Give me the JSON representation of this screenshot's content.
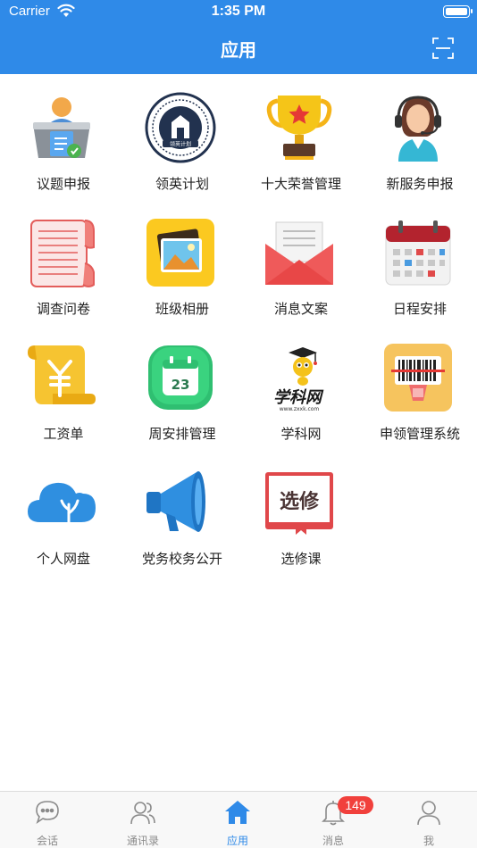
{
  "status_bar": {
    "carrier": "Carrier",
    "time": "1:35 PM"
  },
  "nav": {
    "title": "应用"
  },
  "apps": [
    {
      "label": "议题申报",
      "icon": "presenter-desk-icon"
    },
    {
      "label": "领英计划",
      "icon": "leadership-plan-seal-icon"
    },
    {
      "label": "十大荣誉管理",
      "icon": "trophy-icon"
    },
    {
      "label": "新服务申报",
      "icon": "customer-service-agent-icon"
    },
    {
      "label": "调查问卷",
      "icon": "scroll-paper-icon"
    },
    {
      "label": "班级相册",
      "icon": "photo-album-icon"
    },
    {
      "label": "消息文案",
      "icon": "envelope-icon"
    },
    {
      "label": "日程安排",
      "icon": "calendar-icon"
    },
    {
      "label": "工资单",
      "icon": "yuan-scroll-icon"
    },
    {
      "label": "周安排管理",
      "icon": "weekly-calendar-icon"
    },
    {
      "label": "学科网",
      "icon": "xuekewang-logo-icon"
    },
    {
      "label": "申领管理系统",
      "icon": "barcode-scanner-icon"
    },
    {
      "label": "个人网盘",
      "icon": "cloud-drive-icon"
    },
    {
      "label": "党务校务公开",
      "icon": "megaphone-icon"
    },
    {
      "label": "选修课",
      "icon": "elective-book-icon"
    }
  ],
  "logo_texts": {
    "xuekewang": "学科网",
    "xuekewang_url": "www.zxxk.com",
    "elective": "选修",
    "seal": "领英计划"
  },
  "tabbar": {
    "items": [
      {
        "label": "会话",
        "icon": "chat-bubble-icon"
      },
      {
        "label": "通讯录",
        "icon": "contacts-icon"
      },
      {
        "label": "应用",
        "icon": "home-icon",
        "active": true
      },
      {
        "label": "消息",
        "icon": "bell-icon",
        "badge": "149"
      },
      {
        "label": "我",
        "icon": "profile-icon"
      }
    ]
  },
  "colors": {
    "primary": "#2f8ae8",
    "badge": "#f1403c",
    "tab_inactive": "#8a8a8a"
  }
}
